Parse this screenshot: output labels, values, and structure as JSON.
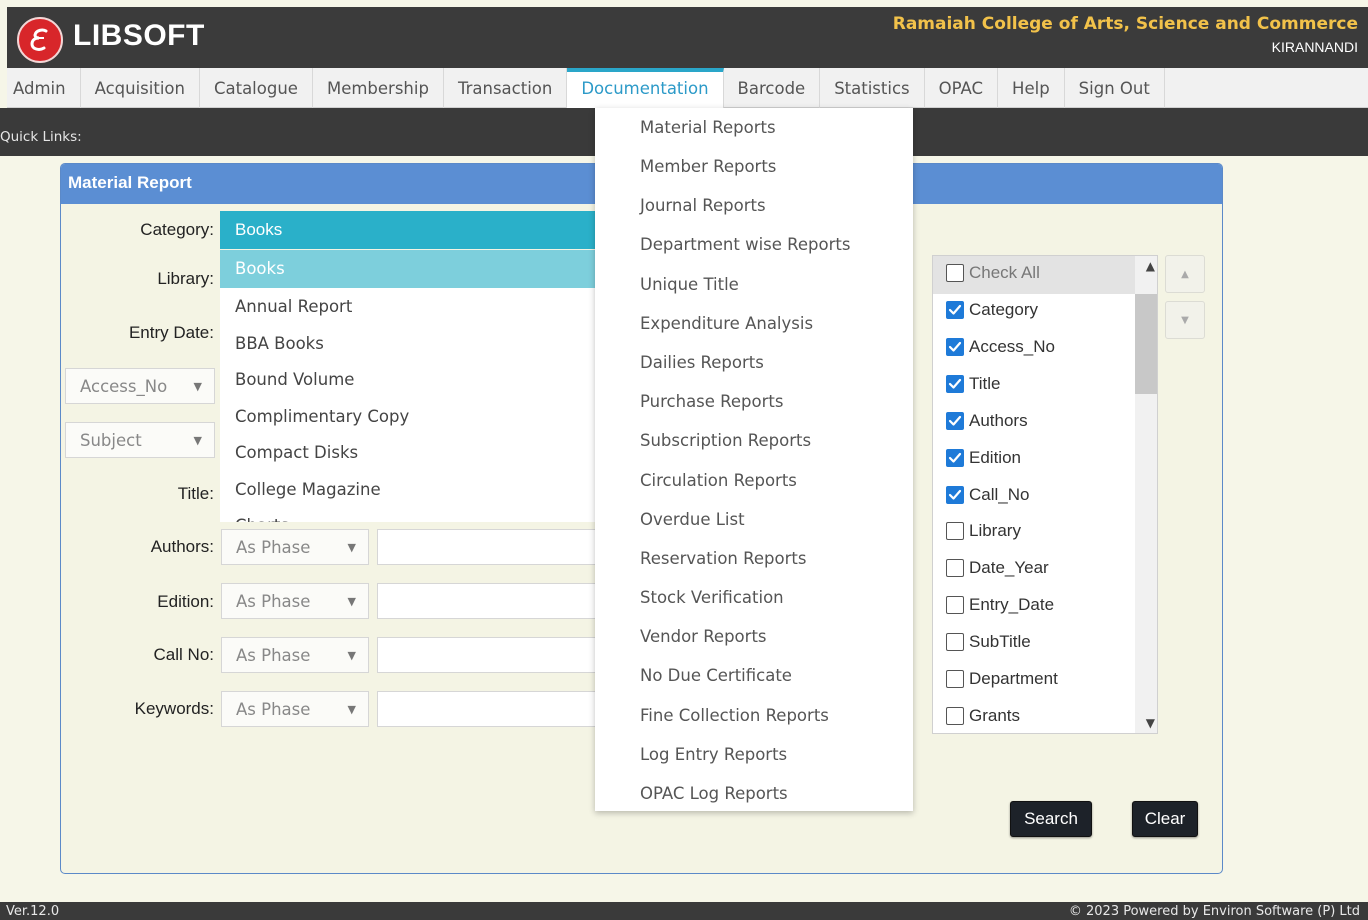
{
  "header": {
    "brand": "LIBSOFT",
    "college": "Ramaiah College of Arts, Science and Commerce",
    "user": "KIRANNANDI"
  },
  "nav": {
    "items": [
      "Admin",
      "Acquisition",
      "Catalogue",
      "Membership",
      "Transaction",
      "Documentation",
      "Barcode",
      "Statistics",
      "OPAC",
      "Help",
      "Sign Out"
    ],
    "active": "Documentation"
  },
  "quick_links_label": "Quick Links:",
  "panel": {
    "title": "Material Report",
    "labels": {
      "category": "Category:",
      "library": "Library:",
      "entry_date": "Entry Date:",
      "title": "Title:",
      "authors": "Authors:",
      "edition": "Edition:",
      "call_no": "Call No:",
      "keywords": "Keywords:"
    },
    "category_value": "Books",
    "category_options": [
      "Books",
      "Annual Report",
      "BBA Books",
      "Bound Volume",
      "Complimentary Copy",
      "Compact Disks",
      "College Magazine",
      "Charts"
    ],
    "field_select_1": "Access_No",
    "field_select_2": "Subject",
    "match_mode": "As Phase"
  },
  "documentation_menu": [
    "Material Reports",
    "Member Reports",
    "Journal Reports",
    "Department wise Reports",
    "Unique Title",
    "Expenditure Analysis",
    "Dailies Reports",
    "Purchase Reports",
    "Subscription Reports",
    "Circulation Reports",
    "Overdue List",
    "Reservation Reports",
    "Stock Verification",
    "Vendor Reports",
    "No Due Certificate",
    "Fine Collection Reports",
    "Log Entry Reports",
    "OPAC Log Reports"
  ],
  "columns": {
    "check_all": "Check All",
    "items": [
      {
        "label": "Category",
        "checked": true
      },
      {
        "label": "Access_No",
        "checked": true
      },
      {
        "label": "Title",
        "checked": true
      },
      {
        "label": "Authors",
        "checked": true
      },
      {
        "label": "Edition",
        "checked": true
      },
      {
        "label": "Call_No",
        "checked": true
      },
      {
        "label": "Library",
        "checked": false
      },
      {
        "label": "Date_Year",
        "checked": false
      },
      {
        "label": "Entry_Date",
        "checked": false
      },
      {
        "label": "SubTitle",
        "checked": false
      },
      {
        "label": "Department",
        "checked": false
      },
      {
        "label": "Grants",
        "checked": false
      }
    ]
  },
  "buttons": {
    "search": "Search",
    "clear": "Clear"
  },
  "footer": {
    "version": "Ver.12.0",
    "copyright": "©  2023   Powered by Environ Software (P) Ltd"
  },
  "colors": {
    "accent": "#2ab0c9",
    "panel_header": "#5b8ed3",
    "header_bg": "#3b3b3b",
    "college_text": "#f2c24a"
  }
}
